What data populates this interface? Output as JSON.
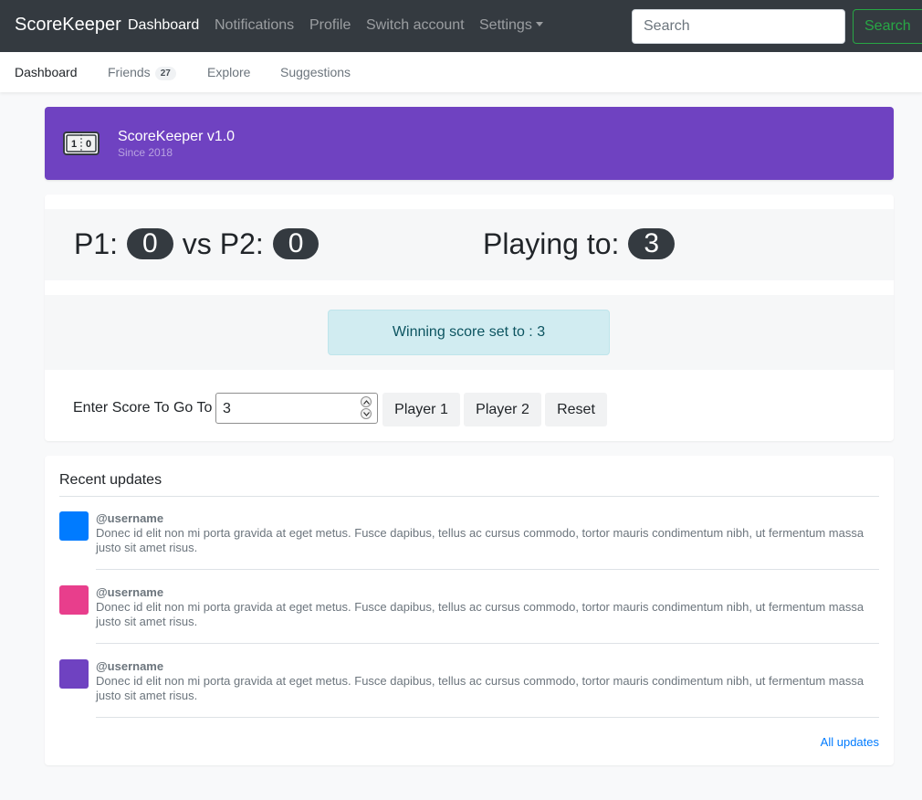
{
  "navbar": {
    "brand": "ScoreKeeper",
    "links": [
      "Dashboard",
      "Notifications",
      "Profile",
      "Switch account",
      "Settings"
    ],
    "active": "Dashboard",
    "search_placeholder": "Search",
    "search_button": "Search"
  },
  "subnav": {
    "dashboard": "Dashboard",
    "friends": "Friends",
    "friends_count": "27",
    "explore": "Explore",
    "suggestions": "Suggestions"
  },
  "banner": {
    "title": "ScoreKeeper v1.0",
    "subtitle": "Since 2018",
    "logo_left": "1",
    "logo_right": "0",
    "color": "#6f42c1"
  },
  "game": {
    "p1_label": "P1:",
    "p1_score": "0",
    "vs": "vs",
    "p2_label": "P2:",
    "p2_score": "0",
    "playing_to_label": "Playing to:",
    "playing_to": "3",
    "alert": "Winning score set to : 3",
    "input_label": "Enter Score To Go To",
    "input_value": "3",
    "player1_button": "Player 1",
    "player2_button": "Player 2",
    "reset_button": "Reset"
  },
  "updates": {
    "title": "Recent updates",
    "items": [
      {
        "username": "@username",
        "text": "Donec id elit non mi porta gravida at eget metus. Fusce dapibus, tellus ac cursus commodo, tortor mauris condimentum nibh, ut fermentum massa justo sit amet risus.",
        "color": "#007bff"
      },
      {
        "username": "@username",
        "text": "Donec id elit non mi porta gravida at eget metus. Fusce dapibus, tellus ac cursus commodo, tortor mauris condimentum nibh, ut fermentum massa justo sit amet risus.",
        "color": "#e83e8c"
      },
      {
        "username": "@username",
        "text": "Donec id elit non mi porta gravida at eget metus. Fusce dapibus, tellus ac cursus commodo, tortor mauris condimentum nibh, ut fermentum massa justo sit amet risus.",
        "color": "#6f42c1"
      }
    ],
    "all_link": "All updates"
  }
}
